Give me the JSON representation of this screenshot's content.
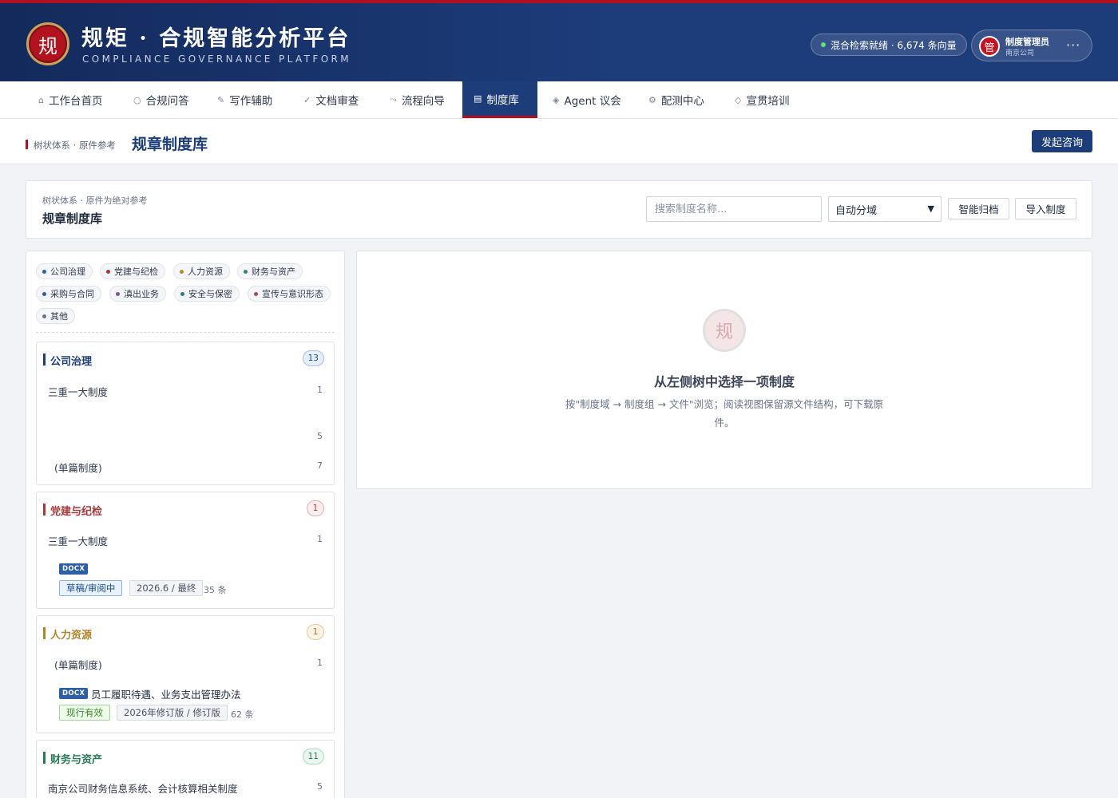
{
  "brand": {
    "seal": "规",
    "title": "规矩 · 合规智能分析平台",
    "subtitle": "COMPLIANCE GOVERNANCE PLATFORM"
  },
  "status": {
    "text": "混合检索就绪 · 6,674 条向量",
    "color": "#5fe07a"
  },
  "user": {
    "avatar": "管",
    "name": "制度管理员",
    "org": "南京公司",
    "more": "···"
  },
  "nav": [
    {
      "icon": "⌂",
      "label": "工作台首页"
    },
    {
      "icon": "○",
      "label": "合规问答"
    },
    {
      "icon": "✎",
      "label": "写作辅助"
    },
    {
      "icon": "✓",
      "label": "文档审查"
    },
    {
      "icon": "⤳",
      "label": "流程向导"
    },
    {
      "icon": "▤",
      "label": "制度库",
      "active": true
    },
    {
      "icon": "◈",
      "label": "Agent 议会"
    },
    {
      "icon": "⚙",
      "label": "配测中心"
    },
    {
      "icon": "◇",
      "label": "宣贯培训"
    }
  ],
  "page_head": {
    "crumb": "树状体系 · 原件参考",
    "title": "规章制度库",
    "consult_button": "发起咨询"
  },
  "toolbar": {
    "subtitle": "树状体系 · 原件为绝对参考",
    "title": "规章制度库",
    "search_placeholder": "搜索制度名称...",
    "domain_select": "自动分域",
    "archive_button": "智能归档",
    "import_button": "导入制度"
  },
  "filters": [
    {
      "label": "公司治理",
      "color": "#2d5ea8"
    },
    {
      "label": "党建与纪检",
      "color": "#a83a3a"
    },
    {
      "label": "人力资源",
      "color": "#c08a2a"
    },
    {
      "label": "财务与资产",
      "color": "#2a8a6a"
    },
    {
      "label": "采购与合同",
      "color": "#3a5a9a"
    },
    {
      "label": "滇出业务",
      "color": "#7a5aa8"
    },
    {
      "label": "安全与保密",
      "color": "#2a7a8a"
    },
    {
      "label": "宣传与意识形态",
      "color": "#a84a5a"
    },
    {
      "label": "其他",
      "color": "#6a7486"
    }
  ],
  "groups": {
    "governance": {
      "title": "公司治理",
      "count": "13",
      "color": "#1c3c7a",
      "rows": [
        {
          "label": "三重一大制度",
          "count": "1"
        },
        {
          "label": "",
          "count": "5"
        },
        {
          "label": "(单篇制度)",
          "count": "7"
        }
      ]
    },
    "party": {
      "title": "党建与纪检",
      "count": "1",
      "color": "#a83a3a",
      "row": {
        "label": "三重一大制度",
        "count": "1"
      },
      "doc": {
        "type": "DOCX",
        "name": "",
        "status": "草稿/审阅中",
        "version": "2026.6 / 最终",
        "items": "35 条"
      }
    },
    "hr": {
      "title": "人力资源",
      "count": "1",
      "color": "#b0852a",
      "row": {
        "label": "(单篇制度)",
        "count": "1"
      },
      "doc": {
        "type": "DOCX",
        "name": "员工履职待遇、业务支出管理办法",
        "status": "现行有效",
        "version": "2026年修订版 / 修订版",
        "items": "62 条"
      }
    },
    "finance": {
      "title": "财务与资产",
      "count": "11",
      "color": "#2a7a5a",
      "row": {
        "label": "南京公司财务信息系统、会计核算相关制度",
        "count": "5"
      }
    }
  },
  "empty_state": {
    "seal": "规",
    "title": "从左侧树中选择一项制度",
    "description": "按\"制度域 → 制度组 → 文件\"浏览；阅读视图保留源文件结构，可下载原件。"
  }
}
